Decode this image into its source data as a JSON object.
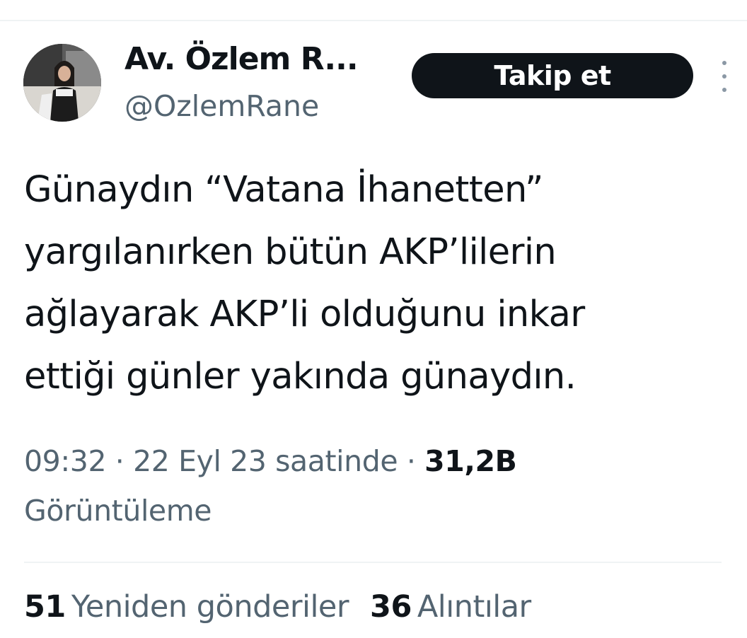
{
  "author": {
    "display_name": "Av. Özlem R...",
    "handle": "@OzlemRane",
    "avatar_icon": "profile-photo"
  },
  "actions": {
    "follow_label": "Takip et",
    "more_icon": "vertical-ellipsis-icon"
  },
  "tweet": {
    "text_lines": [
      "Günaydın “Vatana İhanetten”",
      "yargılanırken bütün AKP’lilerin",
      "ağlayarak AKP’li olduğunu inkar",
      "ettiği günler yakında günaydın."
    ]
  },
  "meta": {
    "time": "09:32",
    "separator": "·",
    "date": "22 Eyl 23 saatinde",
    "views_count": "31,2B",
    "views_label": "Görüntüleme"
  },
  "stats": {
    "retweets_count": "51",
    "retweets_label": "Yeniden gönderiler",
    "quotes_count": "36",
    "quotes_label": "Alıntılar"
  },
  "colors": {
    "primary_text": "#0f1419",
    "secondary_text": "#536471",
    "button_bg": "#0f1419",
    "button_text": "#ffffff",
    "divider": "#eff3f4"
  }
}
